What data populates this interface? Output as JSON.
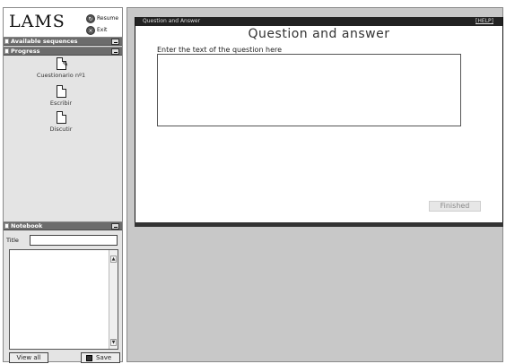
{
  "logo": {
    "text": "LAMS"
  },
  "toolbar": {
    "resume_label": "Resume",
    "exit_label": "Exit"
  },
  "sidebar": {
    "available_sequences_label": "Available sequences",
    "progress_label": "Progress",
    "activities": [
      {
        "label": "Cuestionario nº1"
      },
      {
        "label": "Escribir"
      },
      {
        "label": "Discutir"
      }
    ]
  },
  "notebook": {
    "label": "Notebook",
    "title_label": "Title",
    "title_value": "",
    "notes_value": "",
    "view_all_label": "View all",
    "save_label": "Save"
  },
  "main": {
    "strip_title": "Question and Answer",
    "help_label": "[HELP]",
    "heading": "Question and answer",
    "question_prompt": "Enter the text of the question here",
    "answer_value": "",
    "finished_label": "Finished"
  },
  "colors": {
    "sidebar_bar": "#6c6c6c",
    "header_strip": "#222222",
    "main_bg": "#c8c8c8"
  }
}
